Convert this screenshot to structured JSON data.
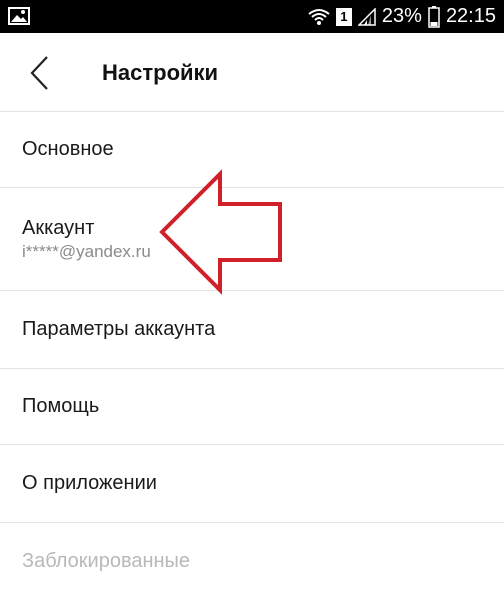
{
  "status_bar": {
    "sim_badge": "1",
    "battery_percent": "23%",
    "time": "22:15"
  },
  "header": {
    "title": "Настройки"
  },
  "settings": {
    "items": [
      {
        "label": "Основное"
      },
      {
        "label": "Аккаунт",
        "sublabel": "i*****@yandex.ru"
      },
      {
        "label": "Параметры аккаунта"
      },
      {
        "label": "Помощь"
      },
      {
        "label": "О приложении"
      },
      {
        "label": "Заблокированные",
        "disabled": true
      }
    ]
  },
  "icons": {
    "status_left": "image-notification-icon",
    "wifi": "wifi-icon",
    "signal": "cellular-signal-icon",
    "battery": "battery-icon",
    "back": "chevron-left-icon",
    "annotation": "red-arrow-annotation"
  },
  "colors": {
    "status_bar_bg": "#000000",
    "text_primary": "#1a1a1a",
    "text_secondary": "#8a8a8a",
    "text_disabled": "#b8b8b8",
    "divider": "#e2e2e2",
    "annotation": "#d0202a"
  }
}
